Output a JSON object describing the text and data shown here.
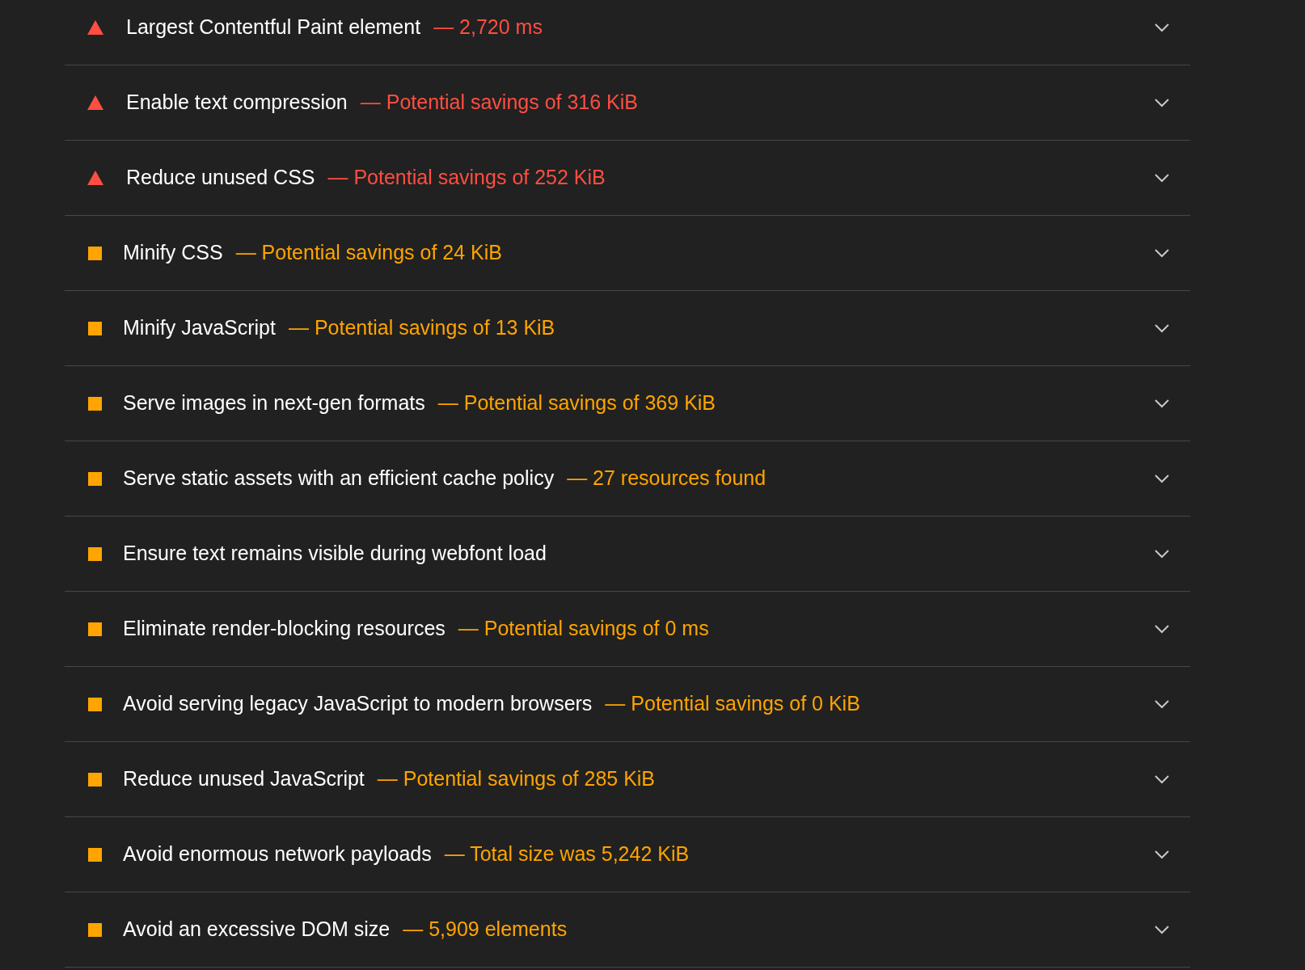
{
  "audits": [
    {
      "kind": "fail",
      "title": "Largest Contentful Paint element",
      "value": "— 2,720 ms"
    },
    {
      "kind": "fail",
      "title": "Enable text compression",
      "value": "— Potential savings of 316 KiB"
    },
    {
      "kind": "fail",
      "title": "Reduce unused CSS",
      "value": "— Potential savings of 252 KiB"
    },
    {
      "kind": "average",
      "title": "Minify CSS",
      "value": "— Potential savings of 24 KiB"
    },
    {
      "kind": "average",
      "title": "Minify JavaScript",
      "value": "— Potential savings of 13 KiB"
    },
    {
      "kind": "average",
      "title": "Serve images in next-gen formats",
      "value": "— Potential savings of 369 KiB"
    },
    {
      "kind": "average",
      "title": "Serve static assets with an efficient cache policy",
      "value": "— 27 resources found"
    },
    {
      "kind": "average",
      "title": "Ensure text remains visible during webfont load"
    },
    {
      "kind": "average",
      "title": "Eliminate render-blocking resources",
      "value": "— Potential savings of 0 ms"
    },
    {
      "kind": "average",
      "title": "Avoid serving legacy JavaScript to modern browsers",
      "value": "— Potential savings of 0 KiB"
    },
    {
      "kind": "average",
      "title": "Reduce unused JavaScript",
      "value": "— Potential savings of 285 KiB"
    },
    {
      "kind": "average",
      "title": "Avoid enormous network payloads",
      "value": "— Total size was 5,242 KiB"
    },
    {
      "kind": "average",
      "title": "Avoid an excessive DOM size",
      "value": "— 5,909 elements"
    }
  ]
}
